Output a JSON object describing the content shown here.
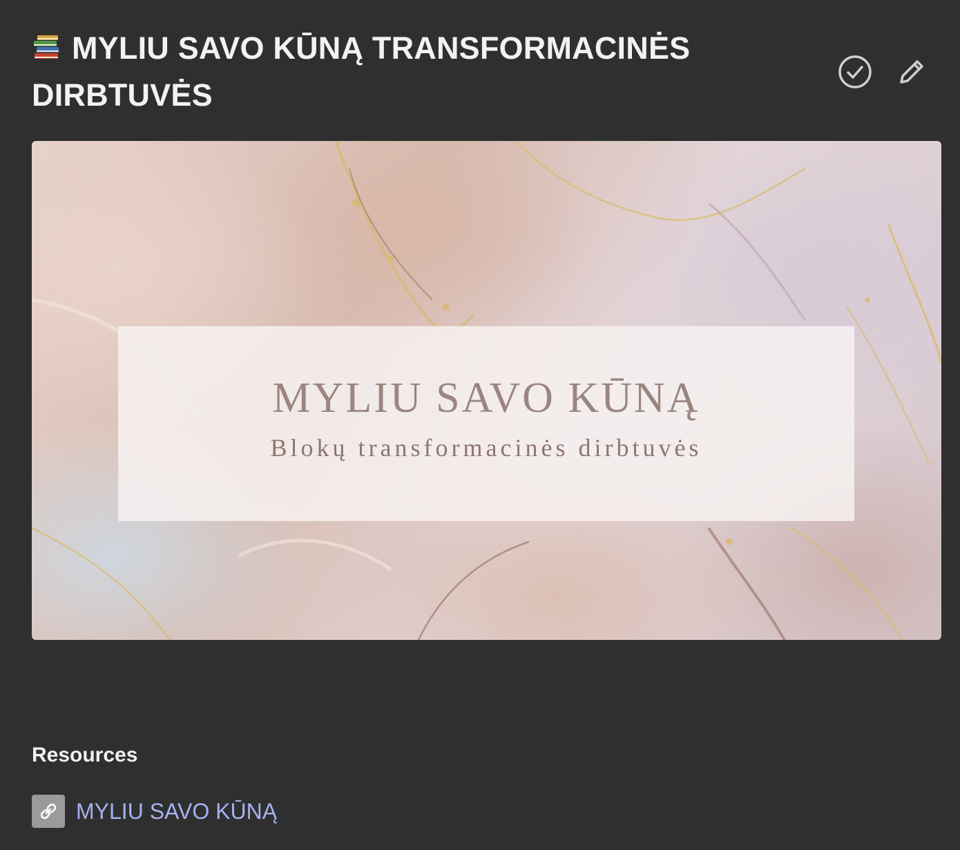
{
  "page": {
    "title_emoji": "books-icon",
    "title": "MYLIU SAVO KŪNĄ TRANSFORMACINĖS DIRBTUVĖS"
  },
  "actions": {
    "complete_icon": "check-circle-icon",
    "edit_icon": "pencil-icon"
  },
  "cover": {
    "title": "MYLIU SAVO KŪNĄ",
    "subtitle": "Blokų transformacinės dirbtuvės"
  },
  "resources": {
    "heading": "Resources",
    "items": [
      {
        "icon": "link-icon",
        "label": "MYLIU SAVO KŪNĄ"
      }
    ]
  },
  "colors": {
    "background": "#2f2f2f",
    "text": "#f2f2f2",
    "link": "#a7b2ef",
    "icon_gray": "#9a9a9a"
  }
}
